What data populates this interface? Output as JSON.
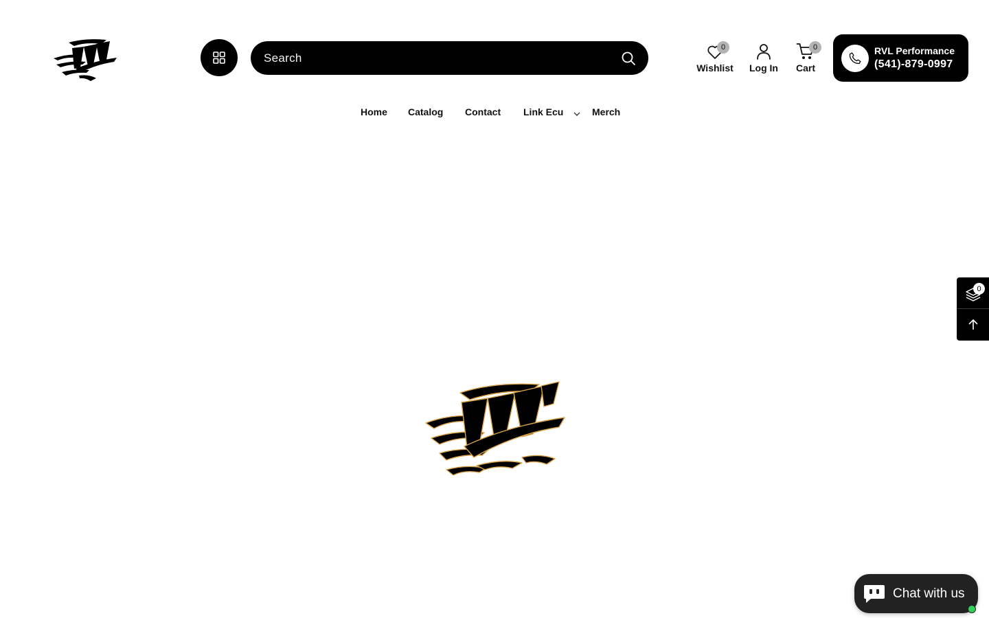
{
  "brand": {
    "logo_alt": "RVL Performance"
  },
  "search": {
    "placeholder": "Search"
  },
  "header_actions": {
    "wishlist": {
      "label": "Wishlist",
      "count": "0"
    },
    "login": {
      "label": "Log In"
    },
    "cart": {
      "label": "Cart",
      "count": "0"
    }
  },
  "contact": {
    "name": "RVL Performance",
    "phone": "(541)-879-0997"
  },
  "nav": {
    "items": [
      {
        "label": "Home"
      },
      {
        "label": "Catalog"
      },
      {
        "label": "Contact"
      },
      {
        "label": "Link Ecu",
        "has_dropdown": true
      },
      {
        "label": "Merch"
      }
    ]
  },
  "side_widget": {
    "compare_count": "0"
  },
  "chat": {
    "label": "Chat with us",
    "status": "online"
  },
  "colors": {
    "primary": "#000000",
    "background": "#ffffff",
    "badge": "#b3b3b3",
    "online": "#2fd15a",
    "chat_bg": "#222222"
  },
  "icons": {
    "menu": "grid-icon",
    "search": "search-icon",
    "wishlist": "heart-icon",
    "login": "user-icon",
    "cart": "cart-icon",
    "phone": "phone-icon",
    "compare": "layers-icon",
    "back_to_top": "arrow-up-icon",
    "chat": "chat-bubble-icon"
  }
}
